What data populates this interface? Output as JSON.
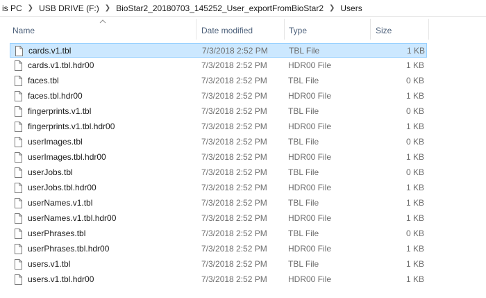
{
  "breadcrumb": {
    "items": [
      "is PC",
      "USB DRIVE (F:)",
      "BioStar2_20180703_145252_User_exportFromBioStar2",
      "Users"
    ]
  },
  "columns": {
    "name": "Name",
    "date_modified": "Date modified",
    "type": "Type",
    "size": "Size"
  },
  "files": [
    {
      "name": "cards.v1.tbl",
      "date": "7/3/2018 2:52 PM",
      "type": "TBL File",
      "size": "1 KB",
      "selected": true
    },
    {
      "name": "cards.v1.tbl.hdr00",
      "date": "7/3/2018 2:52 PM",
      "type": "HDR00 File",
      "size": "1 KB"
    },
    {
      "name": "faces.tbl",
      "date": "7/3/2018 2:52 PM",
      "type": "TBL File",
      "size": "0 KB"
    },
    {
      "name": "faces.tbl.hdr00",
      "date": "7/3/2018 2:52 PM",
      "type": "HDR00 File",
      "size": "1 KB"
    },
    {
      "name": "fingerprints.v1.tbl",
      "date": "7/3/2018 2:52 PM",
      "type": "TBL File",
      "size": "0 KB"
    },
    {
      "name": "fingerprints.v1.tbl.hdr00",
      "date": "7/3/2018 2:52 PM",
      "type": "HDR00 File",
      "size": "1 KB"
    },
    {
      "name": "userImages.tbl",
      "date": "7/3/2018 2:52 PM",
      "type": "TBL File",
      "size": "0 KB"
    },
    {
      "name": "userImages.tbl.hdr00",
      "date": "7/3/2018 2:52 PM",
      "type": "HDR00 File",
      "size": "1 KB"
    },
    {
      "name": "userJobs.tbl",
      "date": "7/3/2018 2:52 PM",
      "type": "TBL File",
      "size": "0 KB"
    },
    {
      "name": "userJobs.tbl.hdr00",
      "date": "7/3/2018 2:52 PM",
      "type": "HDR00 File",
      "size": "1 KB"
    },
    {
      "name": "userNames.v1.tbl",
      "date": "7/3/2018 2:52 PM",
      "type": "TBL File",
      "size": "1 KB"
    },
    {
      "name": "userNames.v1.tbl.hdr00",
      "date": "7/3/2018 2:52 PM",
      "type": "HDR00 File",
      "size": "1 KB"
    },
    {
      "name": "userPhrases.tbl",
      "date": "7/3/2018 2:52 PM",
      "type": "TBL File",
      "size": "0 KB"
    },
    {
      "name": "userPhrases.tbl.hdr00",
      "date": "7/3/2018 2:52 PM",
      "type": "HDR00 File",
      "size": "1 KB"
    },
    {
      "name": "users.v1.tbl",
      "date": "7/3/2018 2:52 PM",
      "type": "TBL File",
      "size": "1 KB"
    },
    {
      "name": "users.v1.tbl.hdr00",
      "date": "7/3/2018 2:52 PM",
      "type": "HDR00 File",
      "size": "1 KB"
    }
  ],
  "icons": {
    "breadcrumb_separator": "chevron-right-icon",
    "sort_indicator": "sort-ascending-icon",
    "file": "blank-file-icon"
  },
  "colors": {
    "selection_bg": "#cce8ff",
    "selection_border": "#99d1ff",
    "header_text": "#4c607a",
    "secondary_text": "#6d6d6d"
  }
}
